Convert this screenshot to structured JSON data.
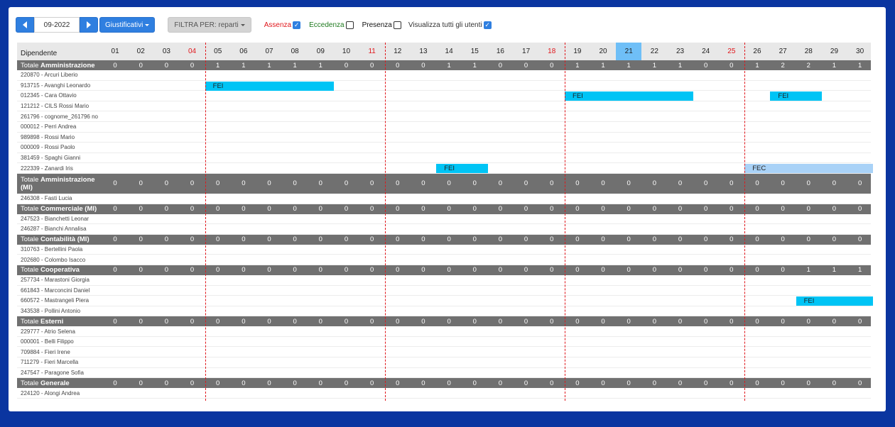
{
  "toolbar": {
    "month": "09-2022",
    "giustificativi_label": "Giustificativi",
    "filtra_label": "FILTRA PER: reparti",
    "assenza_label": "Assenza",
    "assenza_checked": true,
    "eccedenza_label": "Eccedenza",
    "eccedenza_checked": false,
    "presenza_label": "Presenza",
    "presenza_checked": false,
    "visualizza_label": "Visualizza tutti gli utenti",
    "visualizza_checked": true
  },
  "header": {
    "dipendente_label": "Dipendente",
    "days": [
      "01",
      "02",
      "03",
      "04",
      "05",
      "06",
      "07",
      "08",
      "09",
      "10",
      "11",
      "12",
      "13",
      "14",
      "15",
      "16",
      "17",
      "18",
      "19",
      "20",
      "21",
      "22",
      "23",
      "24",
      "25",
      "26",
      "27",
      "28",
      "29",
      "30"
    ],
    "weekend_days": [
      "04",
      "11",
      "18",
      "25"
    ],
    "today": "21"
  },
  "rows": [
    {
      "type": "total",
      "prefix": "Totale",
      "name": "Amministrazione",
      "values": [
        "0",
        "0",
        "0",
        "0",
        "1",
        "1",
        "1",
        "1",
        "1",
        "0",
        "0",
        "0",
        "0",
        "1",
        "1",
        "0",
        "0",
        "0",
        "1",
        "1",
        "1",
        "1",
        "1",
        "0",
        "0",
        "1",
        "2",
        "2",
        "1",
        "1"
      ]
    },
    {
      "type": "emp",
      "name": "220870 - Arcuri Liberio",
      "bars": []
    },
    {
      "type": "emp",
      "name": "913715 - Avanghi Leonardo",
      "bars": [
        {
          "label": "FEI",
          "start": 5,
          "end": 9,
          "style": "cyan"
        }
      ]
    },
    {
      "type": "emp",
      "name": "012345 - Cara Ottavio",
      "bars": [
        {
          "label": "FEI",
          "start": 19,
          "end": 23,
          "style": "cyan"
        },
        {
          "label": "FEI",
          "start": 27,
          "end": 28,
          "style": "cyan"
        }
      ]
    },
    {
      "type": "emp",
      "name": "121212 - CILS Rossi Mario",
      "bars": []
    },
    {
      "type": "emp",
      "name": "261796 - cognome_261796 no",
      "bars": []
    },
    {
      "type": "emp",
      "name": "000012 - Perri Andrea",
      "bars": []
    },
    {
      "type": "emp",
      "name": "989898 - Rossi Mario",
      "bars": []
    },
    {
      "type": "emp",
      "name": "000009 - Rossi Paolo",
      "bars": []
    },
    {
      "type": "emp",
      "name": "381459 - Spaghi Gianni",
      "bars": []
    },
    {
      "type": "emp",
      "name": "222339 - Zanardi Iris",
      "bars": [
        {
          "label": "FEI",
          "start": 14,
          "end": 15,
          "style": "cyan"
        },
        {
          "label": "FEC",
          "start": 26,
          "end": 30,
          "style": "light"
        }
      ]
    },
    {
      "type": "total",
      "tall": true,
      "prefix": "Totale",
      "name": "Amministrazione (MI)",
      "values": [
        "0",
        "0",
        "0",
        "0",
        "0",
        "0",
        "0",
        "0",
        "0",
        "0",
        "0",
        "0",
        "0",
        "0",
        "0",
        "0",
        "0",
        "0",
        "0",
        "0",
        "0",
        "0",
        "0",
        "0",
        "0",
        "0",
        "0",
        "0",
        "0",
        "0"
      ]
    },
    {
      "type": "emp",
      "name": "246308 - Fasti Lucia",
      "bars": []
    },
    {
      "type": "total",
      "prefix": "Totale",
      "name": "Commerciale (MI)",
      "values": [
        "0",
        "0",
        "0",
        "0",
        "0",
        "0",
        "0",
        "0",
        "0",
        "0",
        "0",
        "0",
        "0",
        "0",
        "0",
        "0",
        "0",
        "0",
        "0",
        "0",
        "0",
        "0",
        "0",
        "0",
        "0",
        "0",
        "0",
        "0",
        "0",
        "0"
      ]
    },
    {
      "type": "emp",
      "name": "247523 - Bianchetti Leonar",
      "bars": []
    },
    {
      "type": "emp",
      "name": "246287 - Bianchi Annalisa",
      "bars": []
    },
    {
      "type": "total",
      "prefix": "Totale",
      "name": "Contabilità (MI)",
      "values": [
        "0",
        "0",
        "0",
        "0",
        "0",
        "0",
        "0",
        "0",
        "0",
        "0",
        "0",
        "0",
        "0",
        "0",
        "0",
        "0",
        "0",
        "0",
        "0",
        "0",
        "0",
        "0",
        "0",
        "0",
        "0",
        "0",
        "0",
        "0",
        "0",
        "0"
      ]
    },
    {
      "type": "emp",
      "name": "310763 - Bertellini Paola",
      "bars": []
    },
    {
      "type": "emp",
      "name": "202680 - Colombo Isacco",
      "bars": []
    },
    {
      "type": "total",
      "prefix": "Totale",
      "name": "Cooperativa",
      "values": [
        "0",
        "0",
        "0",
        "0",
        "0",
        "0",
        "0",
        "0",
        "0",
        "0",
        "0",
        "0",
        "0",
        "0",
        "0",
        "0",
        "0",
        "0",
        "0",
        "0",
        "0",
        "0",
        "0",
        "0",
        "0",
        "0",
        "0",
        "1",
        "1",
        "1"
      ]
    },
    {
      "type": "emp",
      "name": "257734 - Marastoni Giorgia",
      "bars": []
    },
    {
      "type": "emp",
      "name": "661843 - Marconcini Daniel",
      "bars": []
    },
    {
      "type": "emp",
      "name": "660572 - Mastrangeli Piera",
      "bars": [
        {
          "label": "FEI",
          "start": 28,
          "end": 30,
          "style": "cyan"
        }
      ]
    },
    {
      "type": "emp",
      "name": "343538 - Pollini Antonio",
      "bars": []
    },
    {
      "type": "total",
      "prefix": "Totale",
      "name": "Esterni",
      "values": [
        "0",
        "0",
        "0",
        "0",
        "0",
        "0",
        "0",
        "0",
        "0",
        "0",
        "0",
        "0",
        "0",
        "0",
        "0",
        "0",
        "0",
        "0",
        "0",
        "0",
        "0",
        "0",
        "0",
        "0",
        "0",
        "0",
        "0",
        "0",
        "0",
        "0"
      ]
    },
    {
      "type": "emp",
      "name": "229777 - Atrio Selena",
      "bars": []
    },
    {
      "type": "emp",
      "name": "000001 - Belli Filippo",
      "bars": []
    },
    {
      "type": "emp",
      "name": "709884 - Fieri Irene",
      "bars": []
    },
    {
      "type": "emp",
      "name": "711279 - Fieri Marcella",
      "bars": []
    },
    {
      "type": "emp",
      "name": "247547 - Paragone Sofia",
      "bars": []
    },
    {
      "type": "total",
      "prefix": "Totale",
      "name": "Generale",
      "values": [
        "0",
        "0",
        "0",
        "0",
        "0",
        "0",
        "0",
        "0",
        "0",
        "0",
        "0",
        "0",
        "0",
        "0",
        "0",
        "0",
        "0",
        "0",
        "0",
        "0",
        "0",
        "0",
        "0",
        "0",
        "0",
        "0",
        "0",
        "0",
        "0",
        "0"
      ]
    },
    {
      "type": "emp",
      "name": "224120 - Alongi Andrea",
      "bars": []
    }
  ],
  "week_separators_after": [
    "04",
    "11",
    "18",
    "25"
  ],
  "colors": {
    "accent": "#2f7fe0",
    "weekend": "#e0161b",
    "total_row": "#707070",
    "bar": "#00c4f5",
    "bar_light": "#a9d2f7",
    "today": "#6fbff7"
  }
}
